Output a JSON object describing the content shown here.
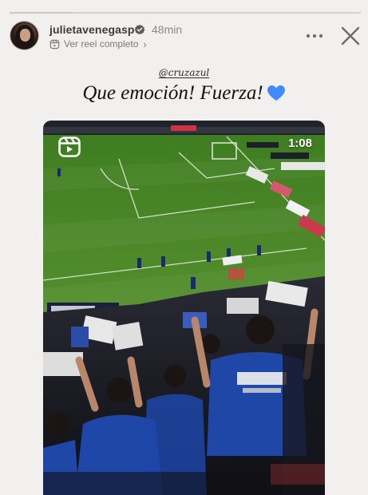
{
  "story": {
    "progress": 0.18,
    "username": "julietavenegasp",
    "verified": true,
    "timestamp": "48min",
    "reel_link_label": "Ver reel completo",
    "mention": "@cruzazul",
    "caption": "Que emoción! Fuerza!",
    "heart_color": "#3d8bff",
    "icons": [
      "verified-icon",
      "reel-icon",
      "more-icon",
      "close-icon",
      "heart-icon",
      "reels-icon"
    ]
  },
  "media": {
    "duration": "1:08",
    "pitch_color": "#4f8a2a",
    "crowd_shirt_color": "#1f47a8"
  }
}
